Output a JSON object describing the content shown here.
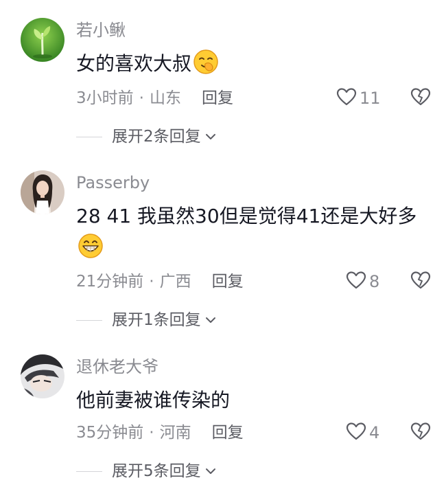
{
  "comments": [
    {
      "username": "若小鳅",
      "text": "女的喜欢大叔",
      "emoji": "smirk-emoji",
      "time": "3小时前",
      "location": "山东",
      "reply_label": "回复",
      "likes": "11",
      "expand_label": "展开2条回复"
    },
    {
      "username": "Passerby",
      "text": "28 41 我虽然30但是觉得41还是大好多",
      "emoji": "grin-emoji",
      "time": "21分钟前",
      "location": "广西",
      "reply_label": "回复",
      "likes": "8",
      "expand_label": "展开1条回复"
    },
    {
      "username": "退休老大爷",
      "text": "他前妻被谁传染的",
      "time": "35分钟前",
      "location": "河南",
      "reply_label": "回复",
      "likes": "4",
      "expand_label": "展开5条回复"
    }
  ],
  "separator": "·",
  "colors": {
    "meta_gray": "#8a8b91",
    "text_dark": "#161823",
    "action_gray": "#5b5c63"
  }
}
